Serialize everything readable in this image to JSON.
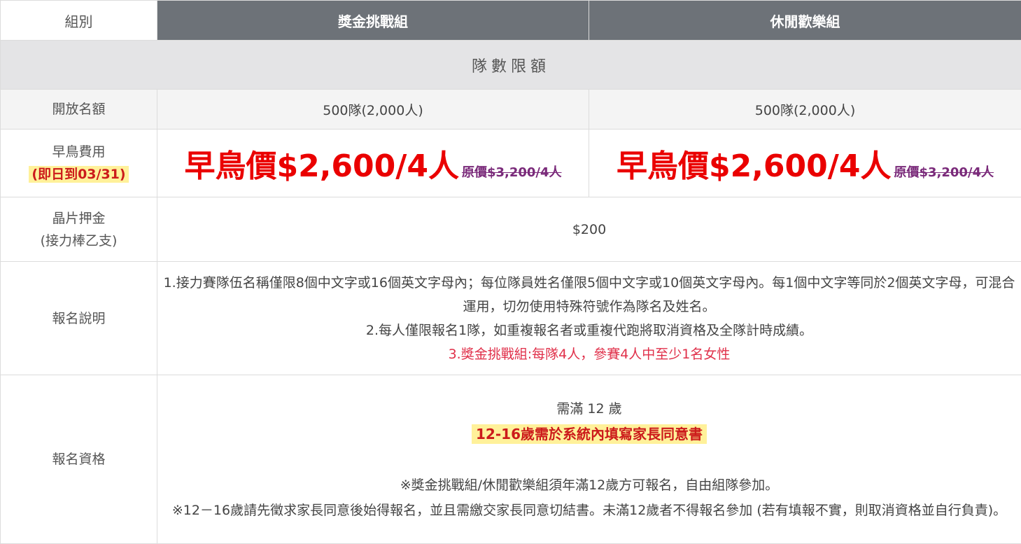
{
  "header": {
    "label": "組別",
    "group1": "獎金挑戰組",
    "group2": "休閒歡樂組"
  },
  "section_title": "隊數限額",
  "quota": {
    "label": "開放名額",
    "group1": "500隊(2,000人)",
    "group2": "500隊(2,000人)"
  },
  "early_bird": {
    "label": "早鳥費用",
    "deadline": "(即日到03/31)",
    "group1_price": "早鳥價$2,600/4人",
    "group1_original": "原價$3,200/4人",
    "group2_price": "早鳥價$2,600/4人",
    "group2_original": "原價$3,200/4人"
  },
  "deposit": {
    "label_line1": "晶片押金",
    "label_line2": "(接力棒乙支)",
    "value": "$200"
  },
  "notes": {
    "label": "報名說明",
    "line1": "1.接力賽隊伍名稱僅限8個中文字或16個英文字母內；每位隊員姓名僅限5個中文字或10個英文字母內。每1個中文字等同於2個英文字母，可混合運用，切勿使用特殊符號作為隊名及姓名。",
    "line2": "2.每人僅限報名1隊，如重複報名者或重複代跑將取消資格及全隊計時成績。",
    "line3": "3.獎金挑戰組:每隊4人，參賽4人中至少1名女性"
  },
  "eligibility": {
    "label": "報名資格",
    "age": "需滿 12 歲",
    "consent": "12-16歲需於系統內填寫家長同意書",
    "note1": "※獎金挑戰組/休閒歡樂組須年滿12歲方可報名，自由組隊參加。",
    "note2": "※12－16歲請先徵求家長同意後始得報名，並且需繳交家長同意切結書。未滿12歲者不得報名參加 (若有填報不實，則取消資格並自行負責)。"
  },
  "colors": {
    "header_bg": "#6d7278",
    "section_bg": "#e4e4e6",
    "price_red": "#ea0000",
    "original_price_purple": "#7a2a7a",
    "highlight_yellow": "#fff19a",
    "note_red": "#e0304a"
  }
}
